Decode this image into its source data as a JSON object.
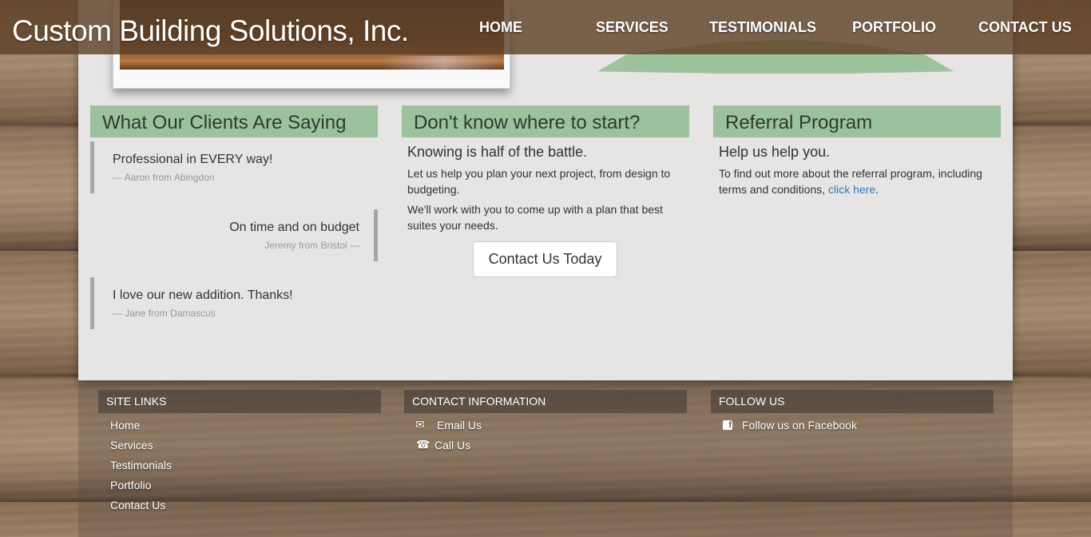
{
  "header": {
    "brand": "Custom Building Solutions, Inc.",
    "nav": [
      "HOME",
      "SERVICES",
      "TESTIMONIALS",
      "PORTFOLIO",
      "CONTACT US"
    ]
  },
  "clients": {
    "title": "What Our Clients Are Saying",
    "quotes": [
      {
        "text": "Professional in EVERY way!",
        "by": "— Aaron from Abingdon"
      },
      {
        "text": "On time and on budget",
        "by": "Jeremy from Bristol —"
      },
      {
        "text": "I love our new addition. Thanks!",
        "by": "— Jane from Damascus"
      }
    ]
  },
  "start": {
    "title": "Don't know where to start?",
    "lead": "Knowing is half of the battle.",
    "p1": "Let us help you plan your next project, from design to budgeting.",
    "p2": "We'll work with you to come up with a plan that best suites your needs.",
    "button": "Contact Us Today"
  },
  "referral": {
    "title": "Referral Program",
    "lead": "Help us help you.",
    "p1": "To find out more about the referral program, including terms and conditions, ",
    "link": "click here",
    "p1_end": "."
  },
  "footer": {
    "site_links_title": "SITE LINKS",
    "site_links": [
      "Home",
      "Services",
      "Testimonials",
      "Portfolio",
      "Contact Us"
    ],
    "contact_title": "CONTACT INFORMATION",
    "email": "Email Us",
    "call": "Call Us",
    "follow_title": "FOLLOW US",
    "facebook": "Follow us on Facebook"
  },
  "icons": {
    "email": "envelope-icon",
    "phone": "phone-icon",
    "facebook": "facebook-icon"
  },
  "colors": {
    "section_header": "#9bc29c",
    "link": "#2a7ac5",
    "header_bar": "#5f4228"
  }
}
